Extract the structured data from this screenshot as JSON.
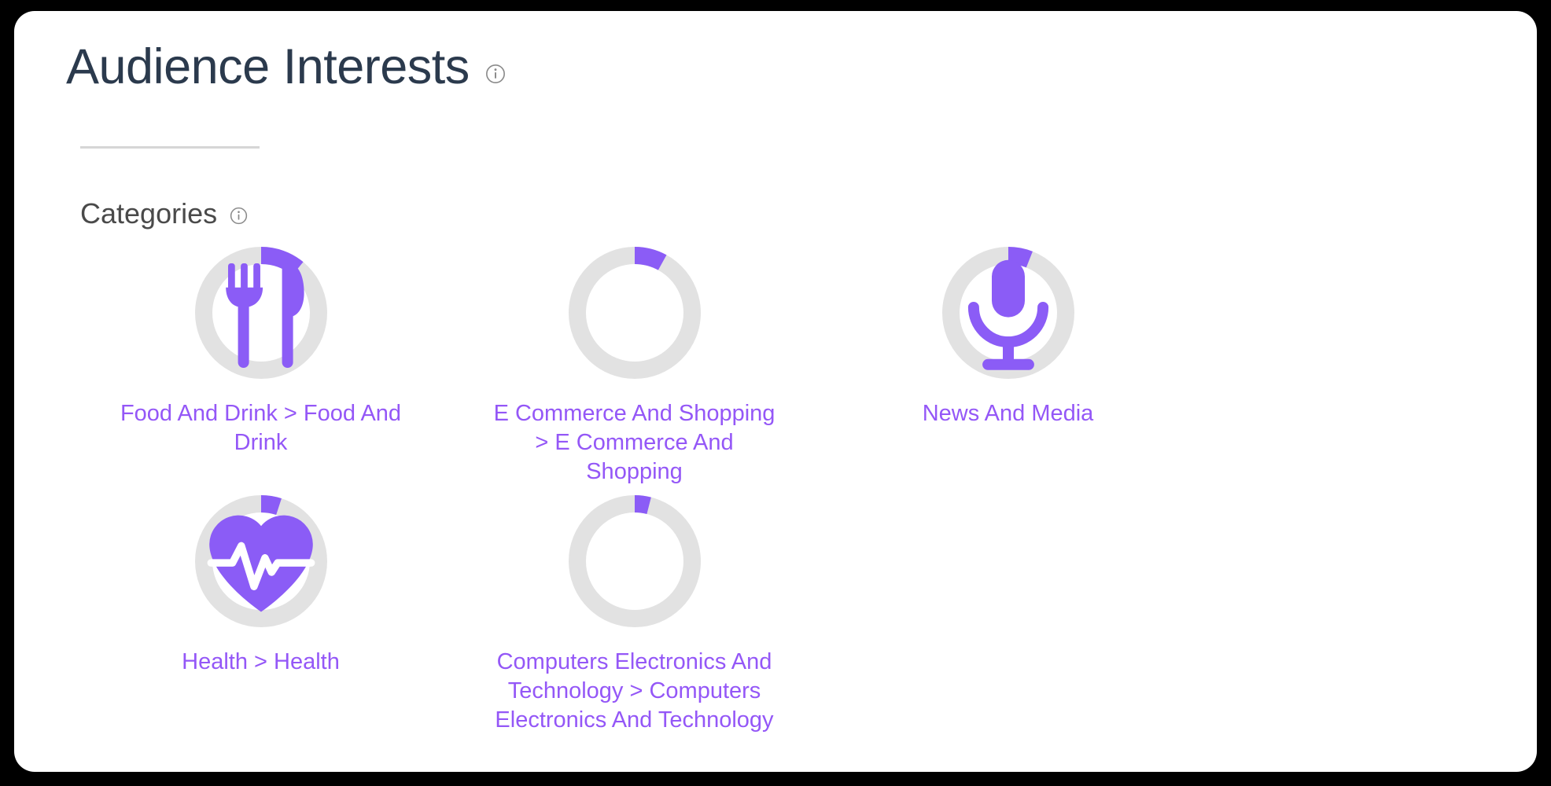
{
  "card": {
    "title": "Audience Interests",
    "title_color": "#2b3a4d",
    "info_icon": "info-circle-icon",
    "section_title": "Categories",
    "section_info_icon": "info-circle-icon"
  },
  "theme": {
    "accent": "#8b5cf6",
    "link": "#9457f7",
    "track": "#e2e2e2",
    "card_bg": "#ffffff",
    "page_bg": "#000000"
  },
  "chart_data": {
    "type": "pie",
    "title": "Categories",
    "subtitle": "Audience Interests",
    "legend": "below-each-donut",
    "note": "Each donut is a single-value ring gauge; value is the share of audience interest for that category, drawn clockwise from 12 o'clock.",
    "ylim": [
      0,
      100
    ],
    "categories": [
      "Food And Drink > Food And Drink",
      "E Commerce And Shopping > E Commerce And Shopping",
      "News And Media",
      "Health > Health",
      "Computers Electronics And Technology > Computers Electronics And Technology"
    ],
    "values": [
      11,
      8,
      6,
      5,
      4
    ]
  },
  "categories": [
    {
      "label": "Food And Drink > Food And Drink",
      "icon": "fork-and-knife-icon",
      "percent": 11
    },
    {
      "label": "E Commerce And Shopping > E Commerce And Shopping",
      "icon": "none",
      "percent": 8
    },
    {
      "label": "News And Media",
      "icon": "microphone-icon",
      "percent": 6
    },
    {
      "label": "Health > Health",
      "icon": "heart-pulse-icon",
      "percent": 5
    },
    {
      "label": "Computers Electronics And Technology > Computers Electronics And Technology",
      "icon": "none",
      "percent": 4
    }
  ]
}
